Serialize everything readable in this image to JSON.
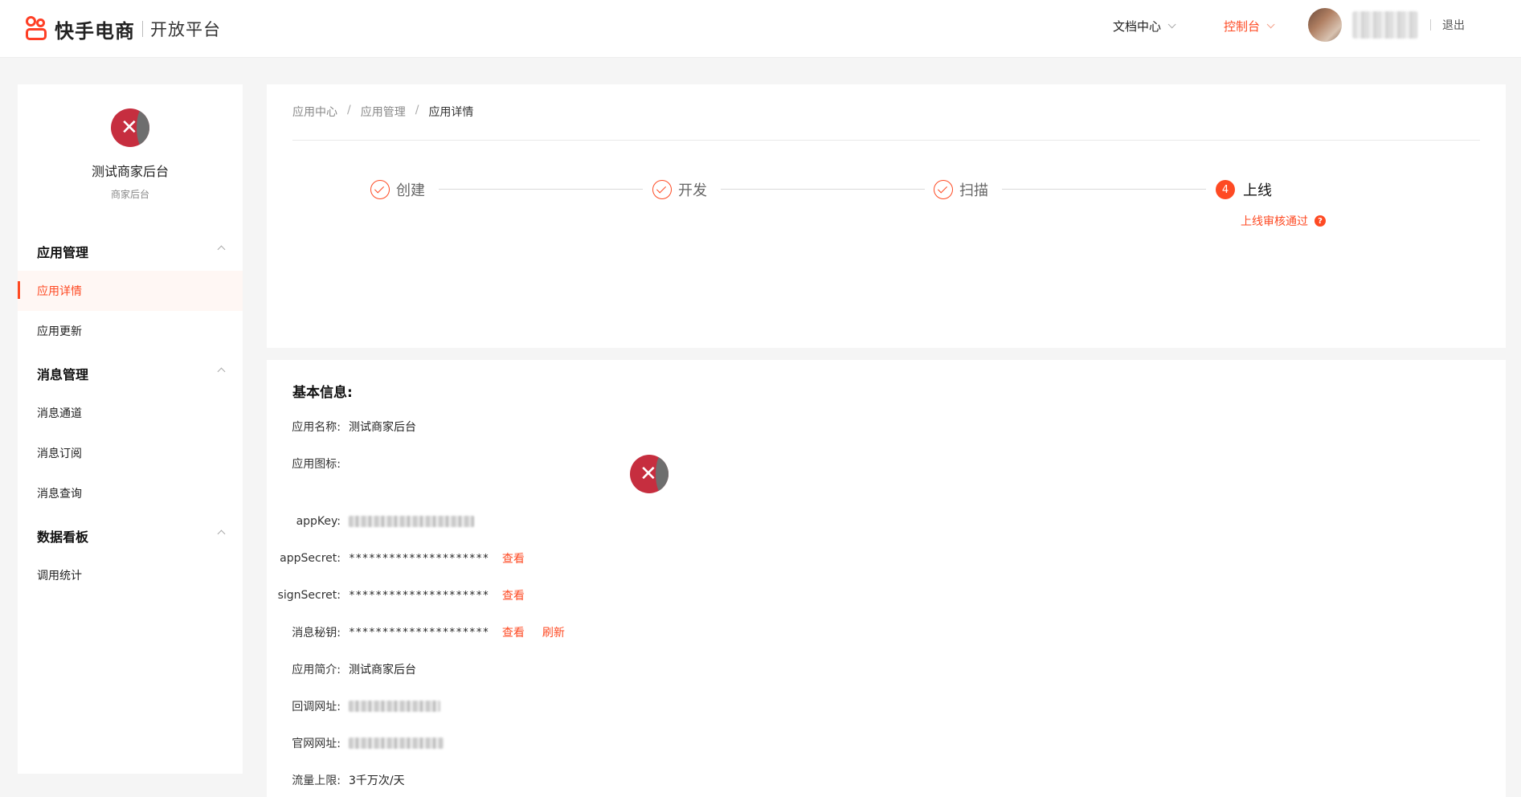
{
  "header": {
    "brand_name": "快手电商",
    "brand_sub": "开放平台",
    "nav_docs": "文档中心",
    "nav_console": "控制台",
    "logout": "退出"
  },
  "sidebar": {
    "app_name": "测试商家后台",
    "app_sub": "商家后台",
    "groups": [
      {
        "label": "应用管理",
        "items": [
          "应用详情",
          "应用更新"
        ]
      },
      {
        "label": "消息管理",
        "items": [
          "消息通道",
          "消息订阅",
          "消息查询"
        ]
      },
      {
        "label": "数据看板",
        "items": [
          "调用统计"
        ]
      }
    ],
    "active_item": "应用详情"
  },
  "breadcrumb": [
    "应用中心",
    "应用管理",
    "应用详情"
  ],
  "steps": [
    {
      "label": "创建",
      "state": "done"
    },
    {
      "label": "开发",
      "state": "done"
    },
    {
      "label": "扫描",
      "state": "done"
    },
    {
      "label": "上线",
      "state": "current",
      "number": "4"
    }
  ],
  "step_status": "上线审核通过",
  "step_status_icon": "?",
  "info": {
    "title": "基本信息:",
    "rows": [
      {
        "label": "应用名称:",
        "value": "测试商家后台"
      },
      {
        "label": "应用图标:",
        "value": ""
      },
      {
        "label": "appKey:",
        "value": ""
      },
      {
        "label": "appSecret:",
        "value": "*********************",
        "action": "查看"
      },
      {
        "label": "signSecret:",
        "value": "*********************",
        "action": "查看"
      },
      {
        "label": "消息秘钥:",
        "value": "*********************",
        "action": "查看",
        "action2": "刷新"
      },
      {
        "label": "应用简介:",
        "value": "测试商家后台"
      },
      {
        "label": "回调网址:",
        "value": ""
      },
      {
        "label": "官网网址:",
        "value": ""
      },
      {
        "label": "流量上限:",
        "value": "3千万次/天"
      }
    ]
  },
  "colors": {
    "accent": "#fe4a23",
    "background": "#f5f5f5"
  }
}
